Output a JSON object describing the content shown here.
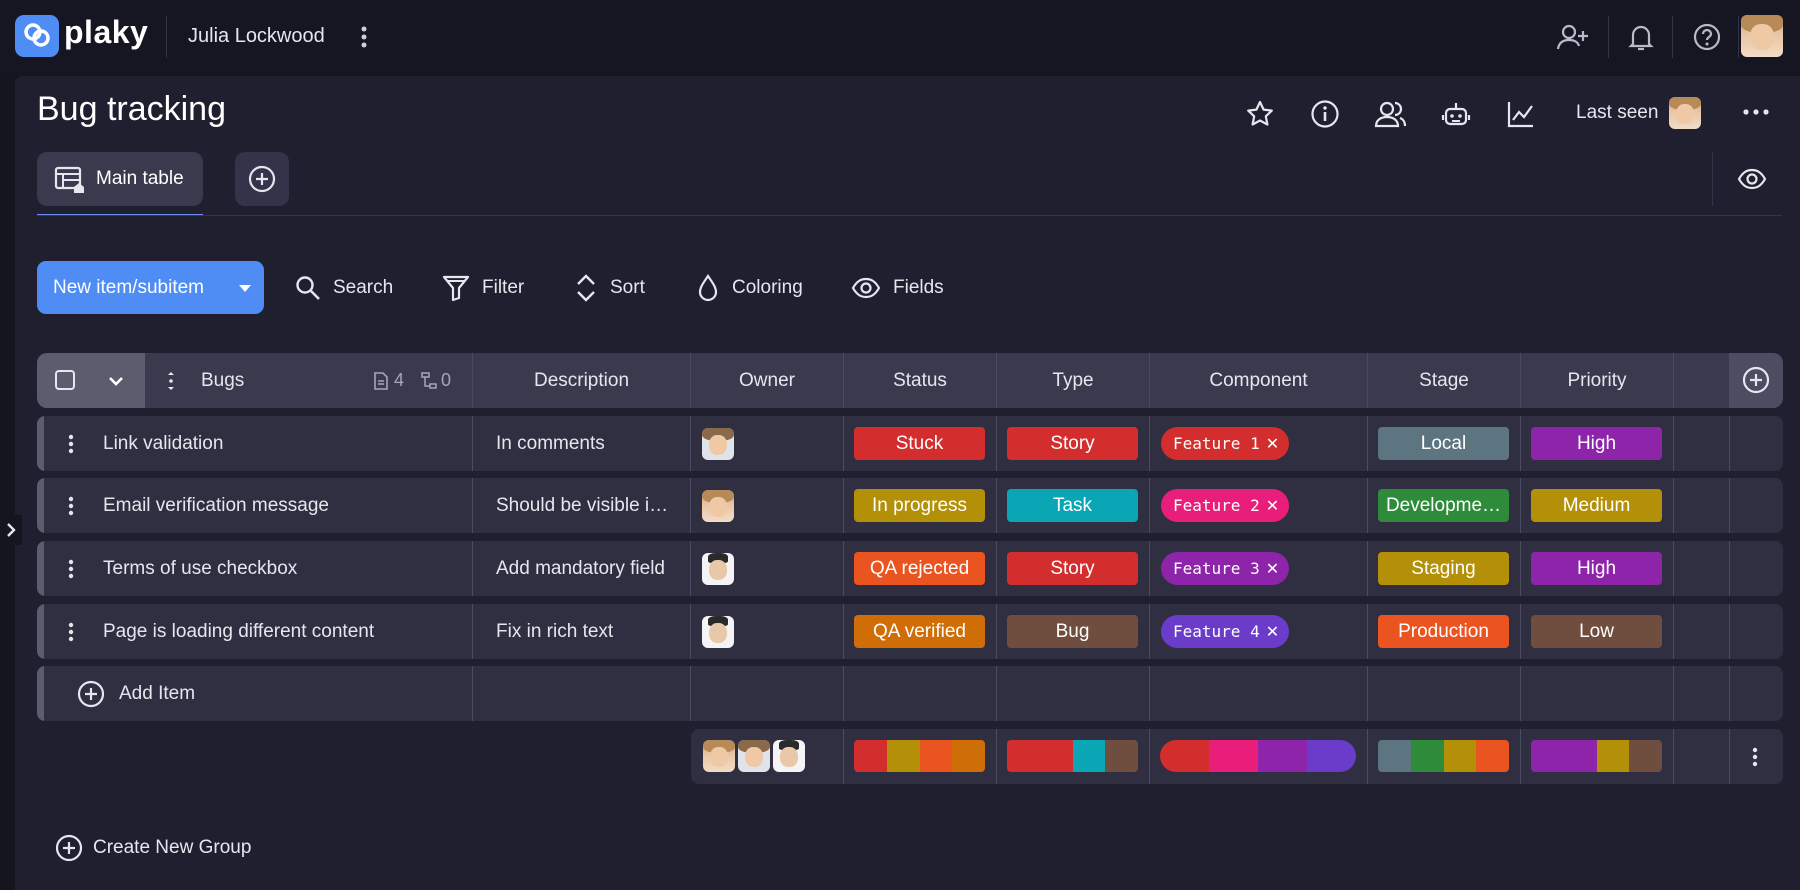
{
  "app": {
    "name": "plaky",
    "user_name": "Julia Lockwood"
  },
  "board": {
    "title": "Bug tracking",
    "last_seen_label": "Last seen"
  },
  "tabs": [
    {
      "label": "Main table"
    }
  ],
  "toolbar": {
    "new_item_label": "New item/subitem",
    "search_label": "Search",
    "filter_label": "Filter",
    "sort_label": "Sort",
    "coloring_label": "Coloring",
    "fields_label": "Fields"
  },
  "group": {
    "name": "Bugs",
    "item_count": "4",
    "subitem_count": "0",
    "columns": [
      "Description",
      "Owner",
      "Status",
      "Type",
      "Component",
      "Stage",
      "Priority"
    ],
    "add_item_label": "Add Item",
    "rows": [
      {
        "name": "Link validation",
        "description": "In comments",
        "status": "Stuck",
        "type": "Story",
        "component": "Feature 1",
        "stage": "Local",
        "priority": "High"
      },
      {
        "name": "Email verification message",
        "description": "Should be visible i…",
        "status": "In progress",
        "type": "Task",
        "component": "Feature 2",
        "stage": "Developme…",
        "priority": "Medium"
      },
      {
        "name": "Terms of use checkbox",
        "description": "Add mandatory field",
        "status": "QA rejected",
        "type": "Story",
        "component": "Feature 3",
        "stage": "Staging",
        "priority": "High"
      },
      {
        "name": "Page is loading different content",
        "description": "Fix in rich text",
        "status": "QA verified",
        "type": "Bug",
        "component": "Feature 4",
        "stage": "Production",
        "priority": "Low"
      }
    ]
  },
  "create_group_label": "Create New Group",
  "colors": {
    "accent": "#4f8df5",
    "stuck": "#d32d2d",
    "in_progress": "#b39008",
    "qa_rejected": "#ea5420",
    "qa_verified": "#cf6e07",
    "story": "#d32d2d",
    "task": "#0aa6b5",
    "bug": "#6f4d3f",
    "feature_1": "#d32d2d",
    "feature_2": "#e91e7a",
    "feature_3": "#8e24aa",
    "feature_4": "#6b3cc9",
    "local": "#5d7580",
    "development": "#2e8b3a",
    "staging": "#b39008",
    "production": "#ea5420",
    "high": "#8e24aa",
    "medium": "#b39008",
    "low": "#6f4d3f"
  }
}
